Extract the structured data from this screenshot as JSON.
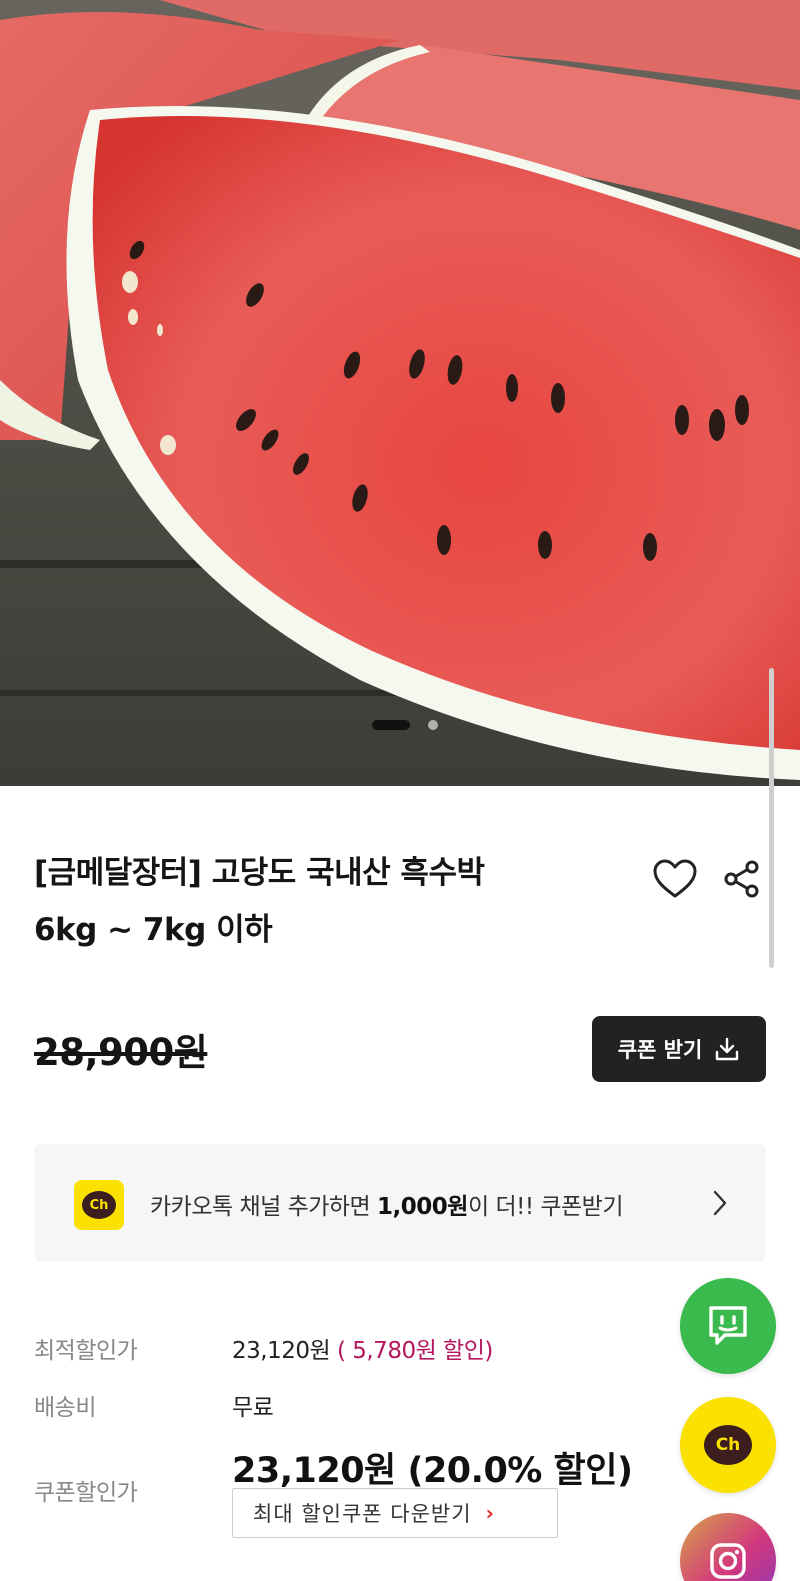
{
  "product": {
    "title_line1": "[금메달장터] 고당도 국내산 흑수박",
    "title_line2": "6kg ~ 7kg 이하",
    "original_price": "28,900원",
    "image_icon": "watermark-slice-image"
  },
  "gallery": {
    "current_index": 1,
    "total": 2
  },
  "actions": {
    "wishlist_icon": "heart-icon",
    "share_icon": "share-icon",
    "coupon_label": "쿠폰 받기",
    "coupon_icon": "download-icon"
  },
  "kakao_banner": {
    "badge": "Ch",
    "text_before": "카카오톡 채널 추가하면 ",
    "text_bold": "1,000원",
    "text_after": "이 더!! 쿠폰받기"
  },
  "price_info": {
    "best_label": "최적할인가",
    "best_value": "23,120원",
    "best_discount": "( 5,780원 할인)",
    "shipping_label": "배송비",
    "shipping_value": "무료",
    "coupon_price_label": "쿠폰할인가",
    "coupon_price_value": "23,120원 (20.0% 할인)",
    "max_coupon_label": "최대 할인쿠폰 다운받기",
    "max_coupon_chevron": "›"
  },
  "floating": {
    "chat_icon": "chat-bubble-icon",
    "kakao_badge": "Ch",
    "instagram_icon": "instagram-icon"
  },
  "colors": {
    "kakao_yellow": "#fae100",
    "chat_green": "#3aba4c",
    "discount_magenta": "#b4175d",
    "coupon_button_bg": "#222222"
  }
}
